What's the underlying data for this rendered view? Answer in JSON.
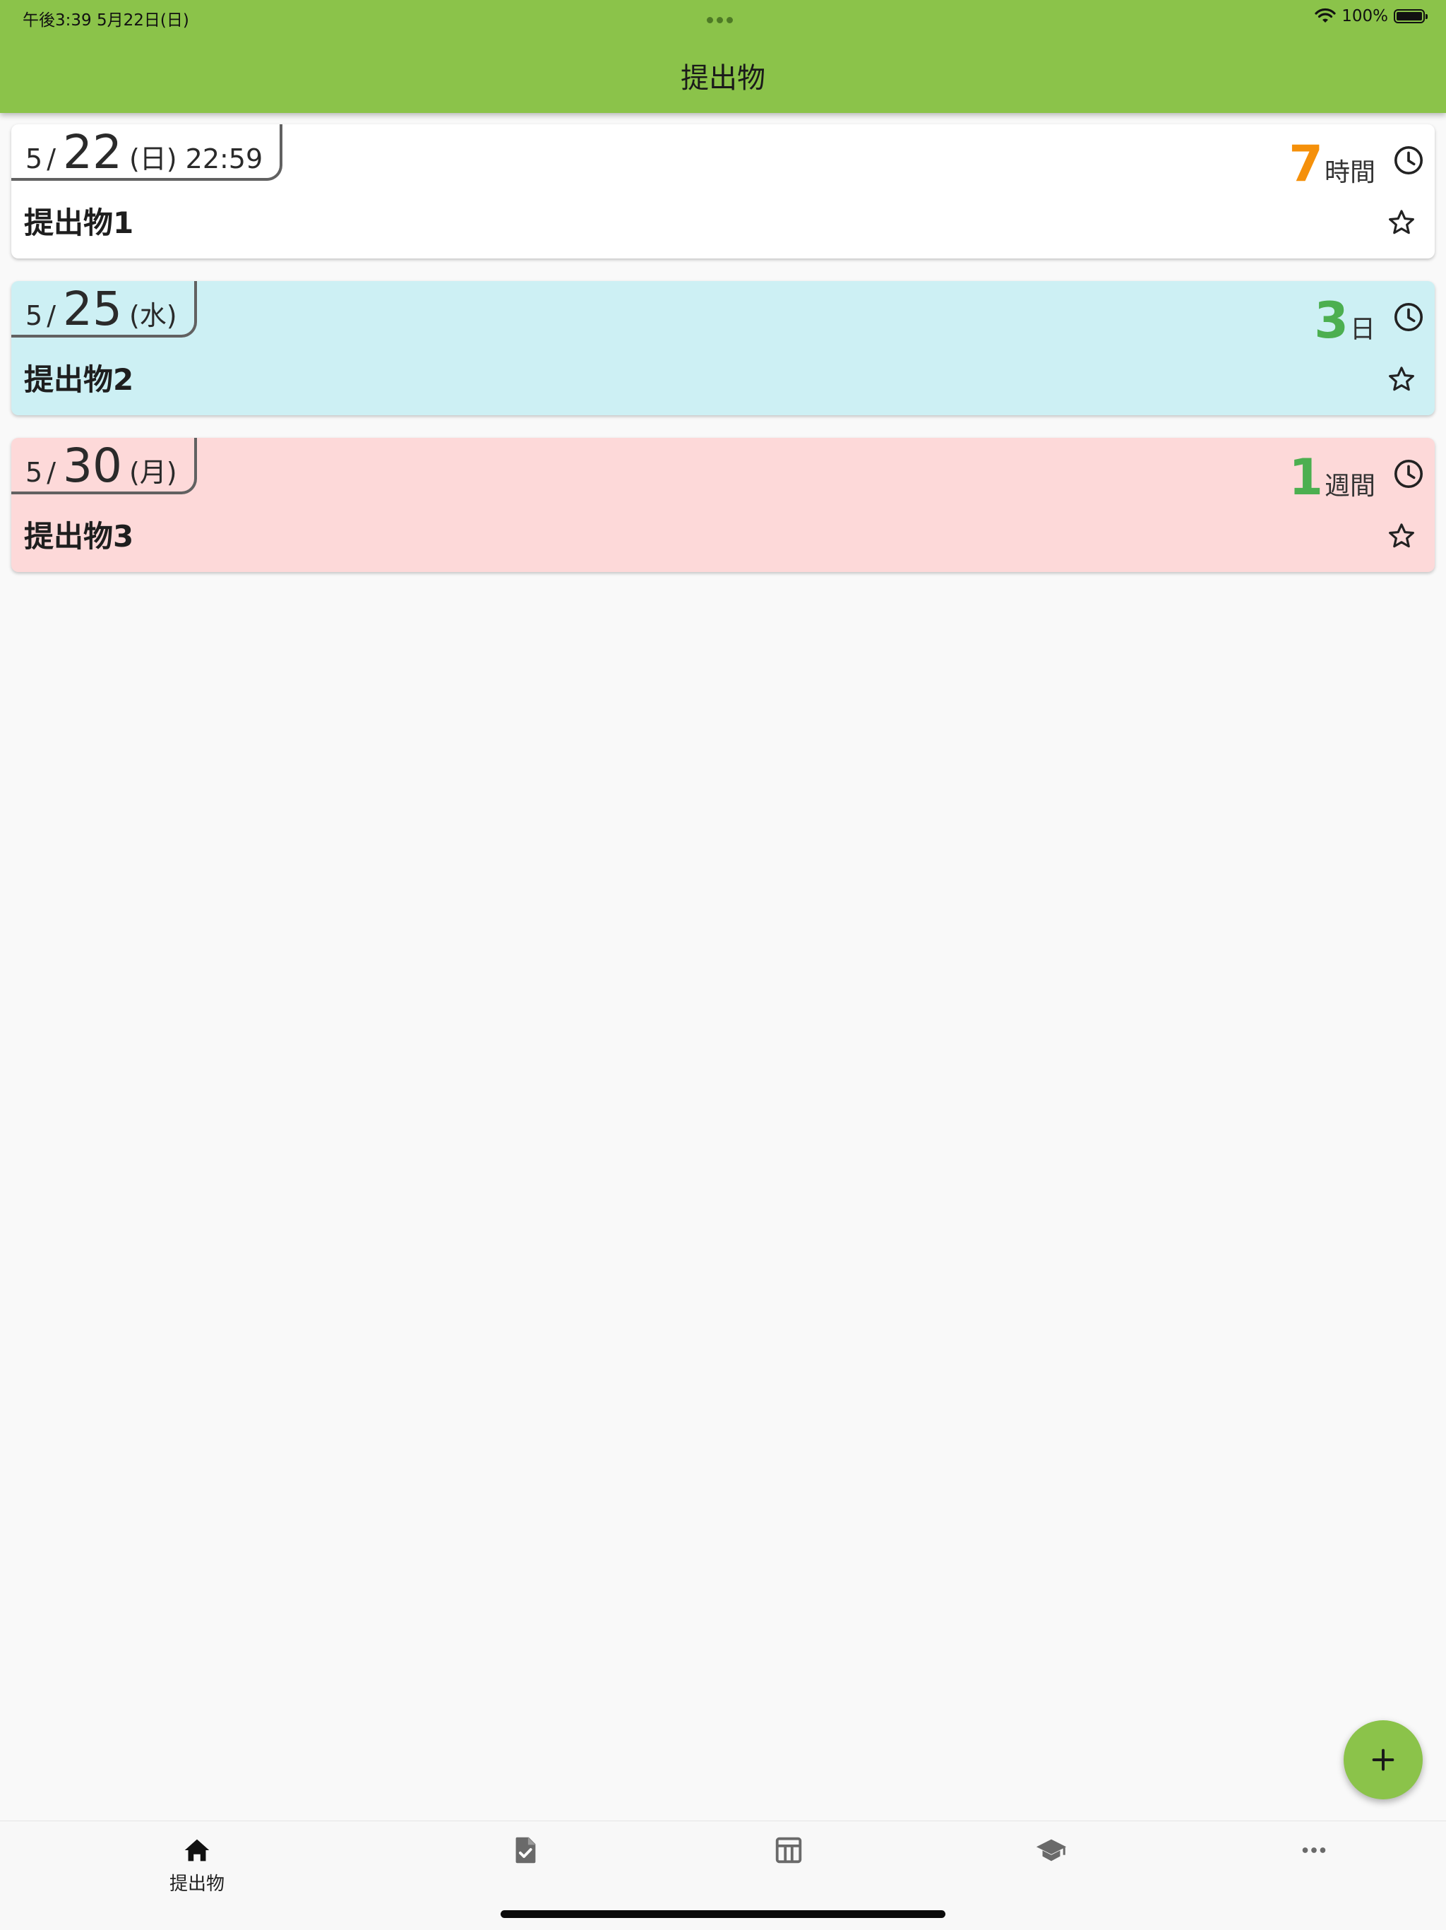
{
  "status_bar": {
    "time_date": "午後3:39   5月22日(日)",
    "battery": "100%",
    "icons": [
      "wifi-icon",
      "battery-icon",
      "multitask-dots-icon"
    ]
  },
  "header": {
    "title": "提出物",
    "color": "#8bc34a"
  },
  "assignments": [
    {
      "month": "5",
      "slash": "/",
      "day": "22",
      "weekday": "(日)",
      "time": "22:59",
      "title": "提出物1",
      "remaining_value": "7",
      "remaining_unit": "時間",
      "remaining_color": "#f5900a",
      "background": "#ffffff"
    },
    {
      "month": "5",
      "slash": "/",
      "day": "25",
      "weekday": "(水)",
      "title": "提出物2",
      "remaining_value": "3",
      "remaining_unit": "日",
      "remaining_color": "#4caf50",
      "background": "#cdf0f4"
    },
    {
      "month": "5",
      "slash": "/",
      "day": "30",
      "weekday": "(月)",
      "title": "提出物3",
      "remaining_value": "1",
      "remaining_unit": "週間",
      "remaining_color": "#4caf50",
      "background": "#fdd9d9"
    }
  ],
  "fab": {
    "icon": "plus-icon",
    "color": "#8bc34a"
  },
  "bottom_nav": [
    {
      "icon": "home-icon",
      "label": "提出物",
      "active": true
    },
    {
      "icon": "assignment-done-icon"
    },
    {
      "icon": "timetable-icon"
    },
    {
      "icon": "school-icon"
    },
    {
      "icon": "more-icon"
    }
  ]
}
